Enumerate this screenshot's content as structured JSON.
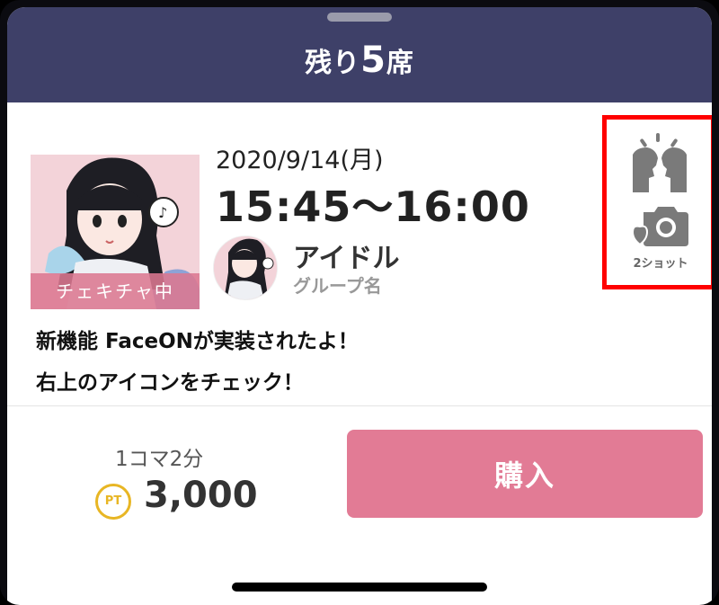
{
  "header": {
    "title_prefix": "残り",
    "seats_count": "5",
    "title_suffix": "席"
  },
  "event": {
    "date": "2020/9/14(月)",
    "time": "15:45～16:00",
    "thumbnail_badge": "チェキチャ中",
    "idol_name": "アイドル",
    "group_name": "グループ名"
  },
  "icons": {
    "face_on": "faceon-icon",
    "two_shot": "camera-icon",
    "two_shot_caption": "2ショット"
  },
  "notice": {
    "line1": "新機能 FaceONが実装されたよ！",
    "line2": "右上のアイコンをチェック！"
  },
  "purchase": {
    "slot_label": "1コマ2分",
    "currency_badge": "PT",
    "price": "3,000",
    "buy_label": "購入"
  },
  "colors": {
    "header_bg": "#3e4068",
    "buy_button": "#e27b95",
    "pt_badge": "#e8b624",
    "highlight": "#ff0000",
    "thumbnail_bg": "#f3d3d9"
  }
}
